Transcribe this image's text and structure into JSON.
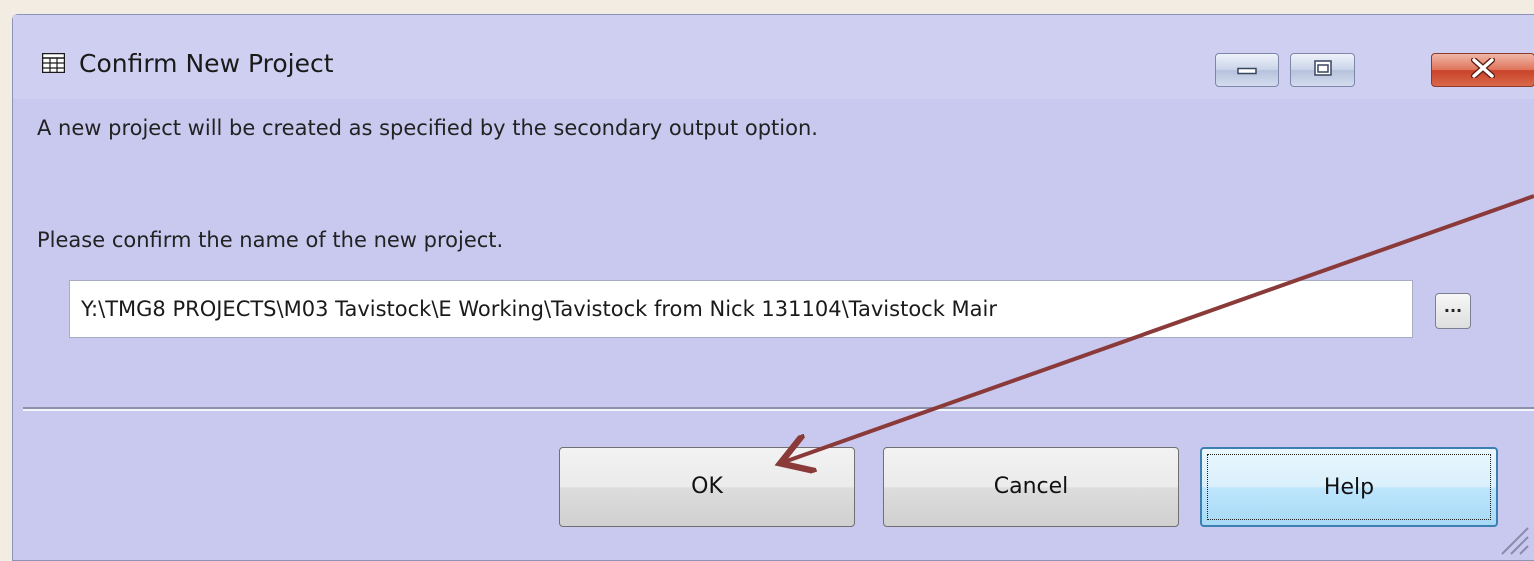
{
  "window": {
    "title": "Confirm New Project",
    "icon": "table-window-icon",
    "controls": [
      "minimize-icon",
      "maximize-icon",
      "close-icon"
    ]
  },
  "dialog": {
    "message": "A new project will be created as specified by the secondary output option.",
    "prompt": "Please confirm the name of the new project.",
    "project_path": "Y:\\TMG8 PROJECTS\\M03 Tavistock\\E Working\\Tavistock from Nick 131104\\Tavistock Mair",
    "browse_label": "..."
  },
  "buttons": {
    "ok_label": "OK",
    "cancel_label": "Cancel",
    "help_label": "Help"
  },
  "colors": {
    "dialog_background": "#c9c9f0",
    "annotation_arrow": "#8b3a3a",
    "close_button": "#c9432a"
  }
}
